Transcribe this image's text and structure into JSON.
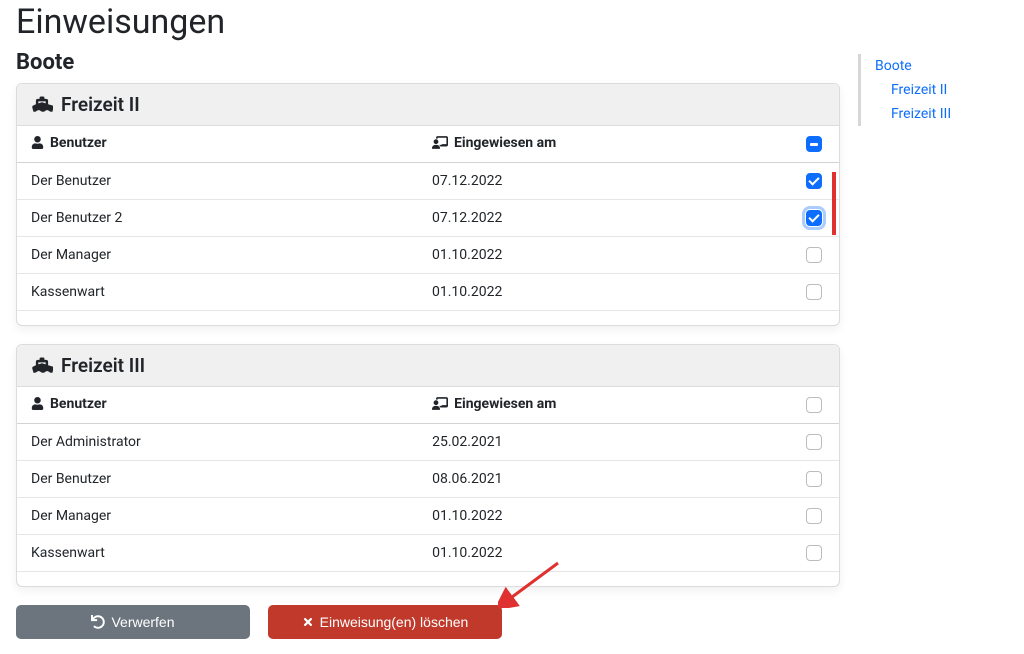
{
  "page_title": "Einweisungen",
  "section_title": "Boote",
  "sidenav": {
    "top": "Boote",
    "items": [
      "Freizeit II",
      "Freizeit III"
    ]
  },
  "columns": {
    "user": "Benutzer",
    "date": "Eingewiesen am"
  },
  "boats": [
    {
      "name": "Freizeit II",
      "header_check": "indeterminate",
      "rows": [
        {
          "user": "Der Benutzer",
          "date": "07.12.2022",
          "checked": true,
          "focus": false
        },
        {
          "user": "Der Benutzer 2",
          "date": "07.12.2022",
          "checked": true,
          "focus": true
        },
        {
          "user": "Der Manager",
          "date": "01.10.2022",
          "checked": false,
          "focus": false
        },
        {
          "user": "Kassenwart",
          "date": "01.10.2022",
          "checked": false,
          "focus": false
        }
      ]
    },
    {
      "name": "Freizeit III",
      "header_check": "unchecked",
      "rows": [
        {
          "user": "Der Administrator",
          "date": "25.02.2021",
          "checked": false,
          "focus": false
        },
        {
          "user": "Der Benutzer",
          "date": "08.06.2021",
          "checked": false,
          "focus": false
        },
        {
          "user": "Der Manager",
          "date": "01.10.2022",
          "checked": false,
          "focus": false
        },
        {
          "user": "Kassenwart",
          "date": "01.10.2022",
          "checked": false,
          "focus": false
        }
      ]
    }
  ],
  "actions": {
    "discard": "Verwerfen",
    "delete": "Einweisung(en) löschen"
  }
}
